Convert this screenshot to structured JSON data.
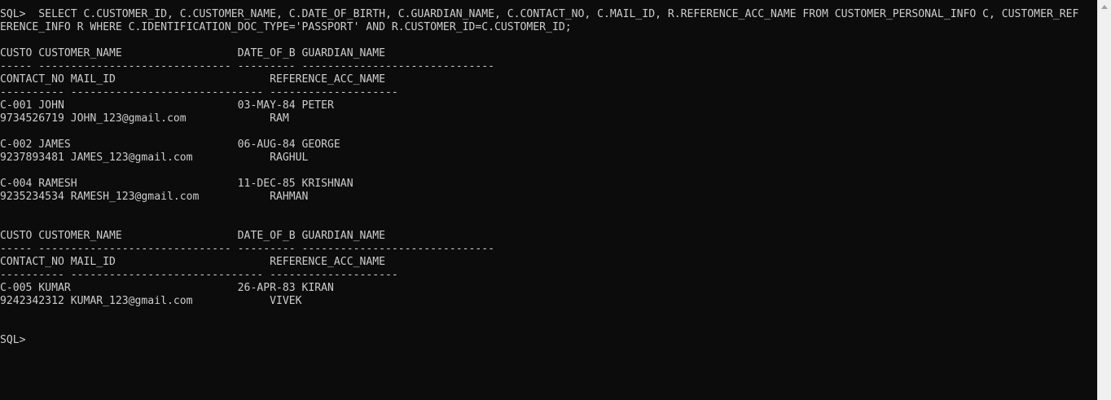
{
  "terminal": {
    "lines": [
      "SQL>  SELECT C.CUSTOMER_ID, C.CUSTOMER_NAME, C.DATE_OF_BIRTH, C.GUARDIAN_NAME, C.CONTACT_NO, C.MAIL_ID, R.REFERENCE_ACC_NAME FROM CUSTOMER_PERSONAL_INFO C, CUSTOMER_REF",
      "ERENCE_INFO R WHERE C.IDENTIFICATION_DOC_TYPE='PASSPORT' AND R.CUSTOMER_ID=C.CUSTOMER_ID;",
      "",
      "CUSTO CUSTOMER_NAME                  DATE_OF_B GUARDIAN_NAME",
      "----- ------------------------------ --------- ------------------------------",
      "CONTACT_NO MAIL_ID                        REFERENCE_ACC_NAME",
      "---------- ------------------------------ --------------------",
      "C-001 JOHN                           03-MAY-84 PETER",
      "9734526719 JOHN_123@gmail.com             RAM",
      "",
      "C-002 JAMES                          06-AUG-84 GEORGE",
      "9237893481 JAMES_123@gmail.com            RAGHUL",
      "",
      "C-004 RAMESH                         11-DEC-85 KRISHNAN",
      "9235234534 RAMESH_123@gmail.com           RAHMAN",
      "",
      "",
      "CUSTO CUSTOMER_NAME                  DATE_OF_B GUARDIAN_NAME",
      "----- ------------------------------ --------- ------------------------------",
      "CONTACT_NO MAIL_ID                        REFERENCE_ACC_NAME",
      "---------- ------------------------------ --------------------",
      "C-005 KUMAR                          26-APR-83 KIRAN",
      "9242342312 KUMAR_123@gmail.com            VIVEK",
      "",
      "",
      "SQL>"
    ]
  },
  "colors": {
    "background": "#0c0c0c",
    "foreground": "#cccccc",
    "scrollbar": "#f0f0f0"
  }
}
